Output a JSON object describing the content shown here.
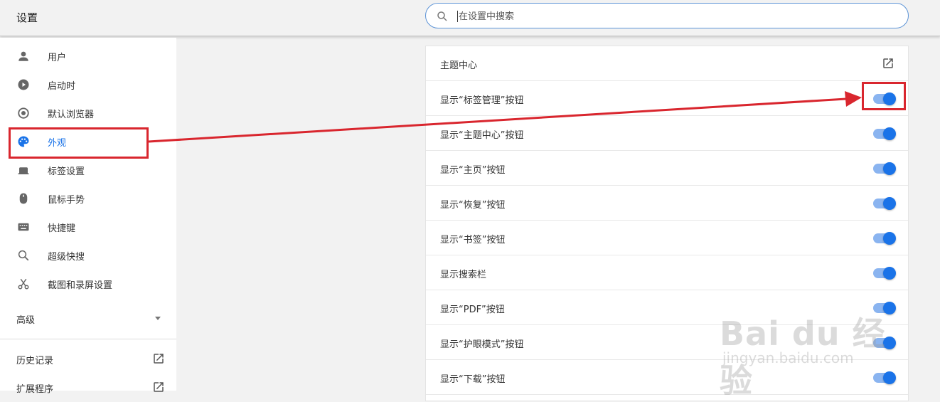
{
  "header": {
    "title": "设置",
    "search": {
      "placeholder": "在设置中搜索",
      "value": ""
    }
  },
  "sidebar": {
    "items": [
      {
        "label": "用户",
        "icon": "person-icon"
      },
      {
        "label": "启动时",
        "icon": "power-icon"
      },
      {
        "label": "默认浏览器",
        "icon": "browser-icon"
      },
      {
        "label": "外观",
        "icon": "palette-icon",
        "active": true
      },
      {
        "label": "标签设置",
        "icon": "tab-icon"
      },
      {
        "label": "鼠标手势",
        "icon": "mouse-icon"
      },
      {
        "label": "快捷键",
        "icon": "keyboard-icon"
      },
      {
        "label": "超级快搜",
        "icon": "search-icon"
      },
      {
        "label": "截图和录屏设置",
        "icon": "scissors-icon"
      }
    ],
    "advanced_label": "高级",
    "links": [
      {
        "label": "历史记录",
        "icon": "external-link-icon"
      },
      {
        "label": "扩展程序",
        "icon": "external-link-icon"
      }
    ]
  },
  "settings": {
    "rows": [
      {
        "label": "主题中心",
        "control": "external-link"
      },
      {
        "label": "显示“标签管理”按钮",
        "control": "toggle",
        "on": true
      },
      {
        "label": "显示“主题中心”按钮",
        "control": "toggle",
        "on": true
      },
      {
        "label": "显示“主页”按钮",
        "control": "toggle",
        "on": true
      },
      {
        "label": "显示“恢复”按钮",
        "control": "toggle",
        "on": true
      },
      {
        "label": "显示“书签”按钮",
        "control": "toggle",
        "on": true
      },
      {
        "label": "显示搜索栏",
        "control": "toggle",
        "on": true
      },
      {
        "label": "显示“PDF”按钮",
        "control": "toggle",
        "on": true
      },
      {
        "label": "显示“护眼模式”按钮",
        "control": "toggle",
        "on": true
      },
      {
        "label": "显示“下载”按钮",
        "control": "toggle",
        "on": true
      }
    ]
  },
  "watermark": {
    "text": "Bai du 经验",
    "sub": "jingyan.baidu.com"
  },
  "colors": {
    "accent": "#1a73e8",
    "toggle_track": "#8ab4f0",
    "annotation": "#d9262e"
  }
}
